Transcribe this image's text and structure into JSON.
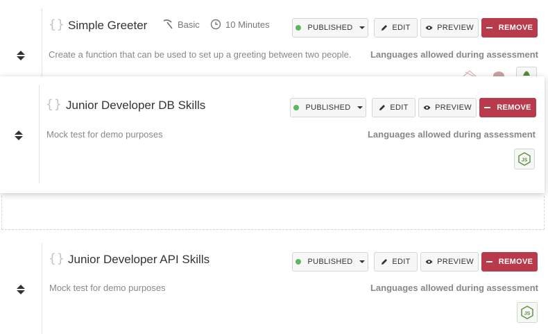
{
  "status_color": "#5cb85c",
  "remove_color": "#b83a4b",
  "languages_label": "Languages allowed during assessment",
  "buttons": {
    "status": "PUBLISHED",
    "edit": "EDIT",
    "preview": "PREVIEW",
    "remove": "REMOVE"
  },
  "tests": [
    {
      "title": "Simple Greeter",
      "difficulty": "Basic",
      "duration": "10 Minutes",
      "description": "Create a function that can be used to set up a greeting between two people.",
      "language_icon": "nodejs-icon"
    },
    {
      "title": "Junior Developer DB Skills",
      "description": "Mock test for demo purposes",
      "language_icon": "nodejs-icon"
    },
    {
      "title": "Junior Developer API Skills",
      "description": "Mock test for demo purposes",
      "language_icon": "nodejs-icon"
    }
  ]
}
